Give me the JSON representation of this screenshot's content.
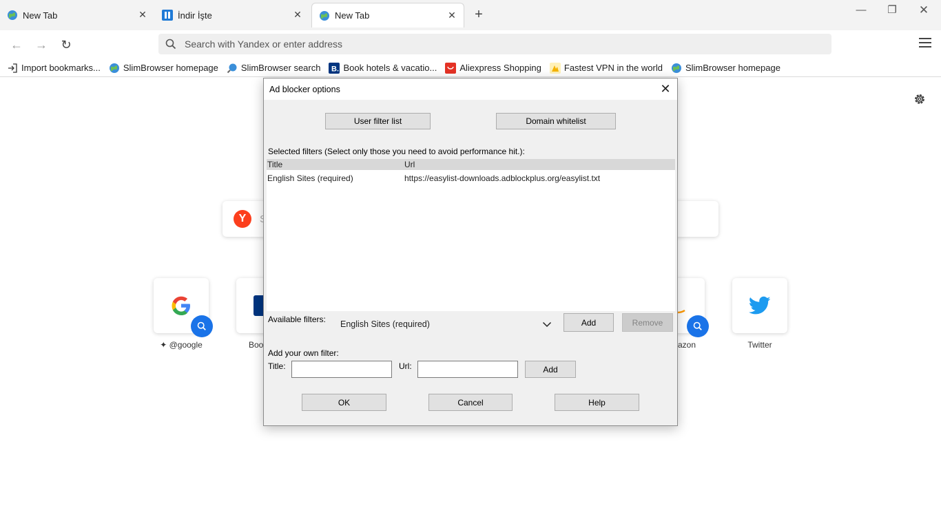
{
  "tabs": [
    {
      "title": "New Tab",
      "active": false
    },
    {
      "title": "İndir İşte",
      "active": false
    },
    {
      "title": "New Tab",
      "active": true
    }
  ],
  "toolbar": {
    "address_placeholder": "Search with Yandex or enter address"
  },
  "bookmarks": [
    {
      "label": "Import bookmarks...",
      "icon": "import-icon"
    },
    {
      "label": "SlimBrowser homepage",
      "icon": "globe-icon"
    },
    {
      "label": "SlimBrowser search",
      "icon": "search-globe-icon"
    },
    {
      "label": "Book hotels & vacatio...",
      "icon": "booking-icon"
    },
    {
      "label": "Aliexpress Shopping",
      "icon": "aliexpress-icon"
    },
    {
      "label": "Fastest VPN in the world",
      "icon": "vpn-icon"
    },
    {
      "label": "SlimBrowser homepage",
      "icon": "globe-icon"
    }
  ],
  "newtab": {
    "search_placeholder_partial": "S",
    "tiles": [
      {
        "label": "@google"
      },
      {
        "label": "Boo"
      },
      {
        "label": "azon"
      },
      {
        "label": "Twitter"
      }
    ]
  },
  "dialog": {
    "title": "Ad blocker options",
    "user_filter_list": "User filter list",
    "domain_whitelist": "Domain whitelist",
    "selected_filters_label": "Selected filters (Select only those you need to avoid performance hit.):",
    "list_headers": {
      "title": "Title",
      "url": "Url"
    },
    "rows": [
      {
        "title": "English Sites (required)",
        "url": "https://easylist-downloads.adblockplus.org/easylist.txt"
      }
    ],
    "available_filters_label": "Available filters:",
    "available_selected": "English Sites (required)",
    "add_label": "Add",
    "remove_label": "Remove",
    "own_filter_label": "Add your own filter:",
    "title_field_label": "Title:",
    "url_field_label": "Url:",
    "title_value": "",
    "url_value": "",
    "add_own_label": "Add",
    "ok_label": "OK",
    "cancel_label": "Cancel",
    "help_label": "Help"
  },
  "colors": {
    "yandex": "#fc3f1d",
    "accent_blue": "#1a73e8",
    "twitter": "#1d9bf0"
  }
}
